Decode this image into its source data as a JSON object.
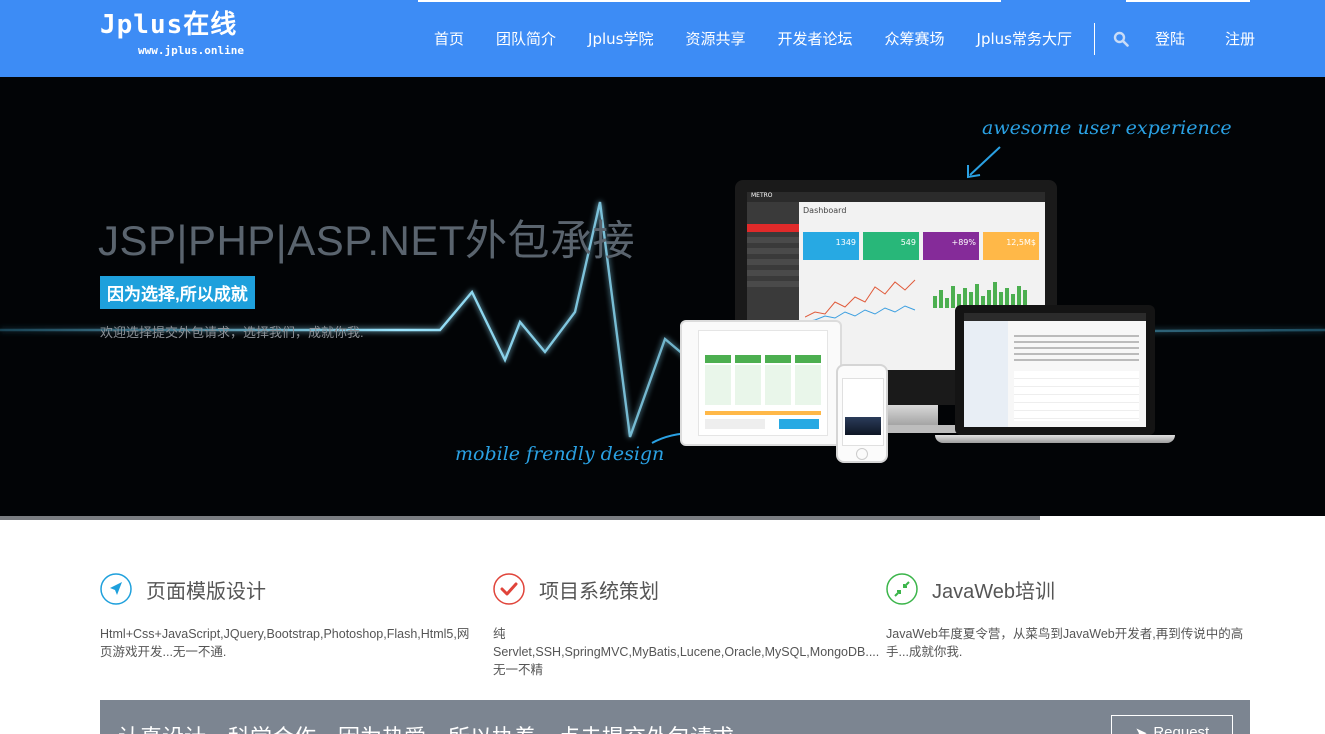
{
  "header": {
    "logo": "Jplus在线",
    "logo_sub": "www.jplus.online",
    "nav": [
      "首页",
      "团队简介",
      "Jplus学院",
      "资源共享",
      "开发者论坛",
      "众筹赛场",
      "Jplus常务大厅"
    ],
    "search_icon": "search-icon",
    "login": "登陆",
    "register": "注册",
    "brand_color": "#3d8cf5"
  },
  "hero": {
    "headline": "JSP|PHP|ASP.NET外包承接",
    "badge": "因为选择,所以成就",
    "text": "欢迎选择提交外包请求，选择我们，成就你我.",
    "annotation_top": "awesome user experience",
    "annotation_bottom": "mobile frendly design",
    "device_dashboard_title": "Dashboard",
    "device_logo": "METRO",
    "stats": [
      "1349",
      "549",
      "+89%",
      "12,5M$"
    ],
    "slide_progress": 0.785
  },
  "features": [
    {
      "icon": "navigation-arrow-icon",
      "title": "页面模版设计",
      "desc": "Html+Css+JavaScript,JQuery,Bootstrap,Photoshop,Flash,Html5,网页游戏开发...无一不通.",
      "color": "#1ea0dc"
    },
    {
      "icon": "checkmark-icon",
      "title": "项目系统策划",
      "desc": "纯Servlet,SSH,SpringMVC,MyBatis,Lucene,Oracle,MySQL,MongoDB....无一不精",
      "color": "#e0443a"
    },
    {
      "icon": "compress-arrows-icon",
      "title": "JavaWeb培训",
      "desc": "JavaWeb年度夏令营，从菜鸟到JavaWeb开发者,再到传说中的高手...成就你我.",
      "color": "#3bb54a"
    }
  ],
  "cta": {
    "text": "认真设计，科学合作，因为热爱，所以执着，点击提交外包请求",
    "button": "Request"
  }
}
